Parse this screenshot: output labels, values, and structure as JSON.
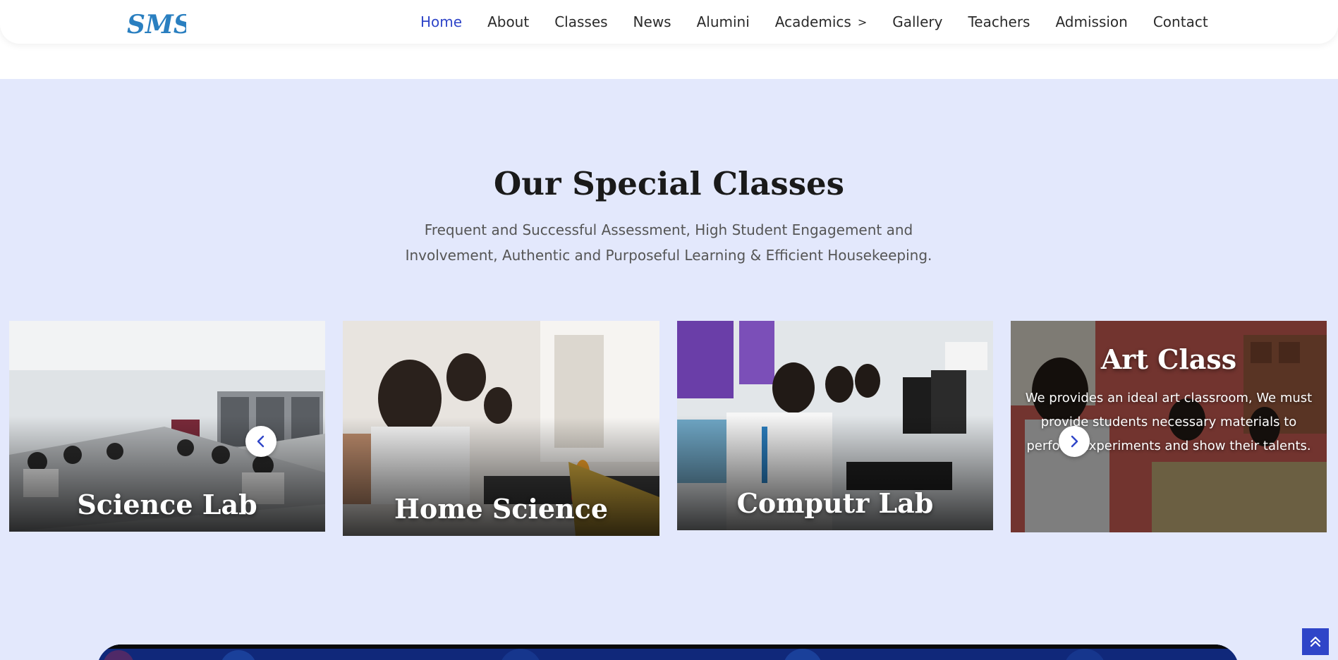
{
  "header": {
    "logo_text": "SMS",
    "nav": [
      {
        "label": "Home",
        "active": true
      },
      {
        "label": "About"
      },
      {
        "label": "Classes"
      },
      {
        "label": "News"
      },
      {
        "label": "Alumini"
      },
      {
        "label": "Academics",
        "has_submenu": true,
        "chevron": ">"
      },
      {
        "label": "Gallery"
      },
      {
        "label": "Teachers"
      },
      {
        "label": "Admission"
      },
      {
        "label": "Contact"
      }
    ]
  },
  "section": {
    "title": "Our Special Classes",
    "subtitle": "Frequent and Successful Assessment, High Student Engagement and Involvement, Authentic and Purposeful Learning & Efficient Housekeeping."
  },
  "cards": [
    {
      "title": "Science Lab"
    },
    {
      "title": "Home Science"
    },
    {
      "title": "Computr Lab"
    },
    {
      "title": "Art Class",
      "description": "We provides an ideal art classroom, We must provide students necessary materials to perform experiments and show their talents."
    }
  ],
  "icons": {
    "prev": "chevron-left-icon",
    "next": "chevron-right-icon",
    "submenu": "chevron-right-icon",
    "scroll_top": "double-chevron-up-icon"
  },
  "colors": {
    "accent": "#2f45c8",
    "section_bg": "#e3e8fc",
    "logo_blue": "#2a7fc0",
    "title": "#1a1a1a",
    "subtitle": "#555555"
  }
}
